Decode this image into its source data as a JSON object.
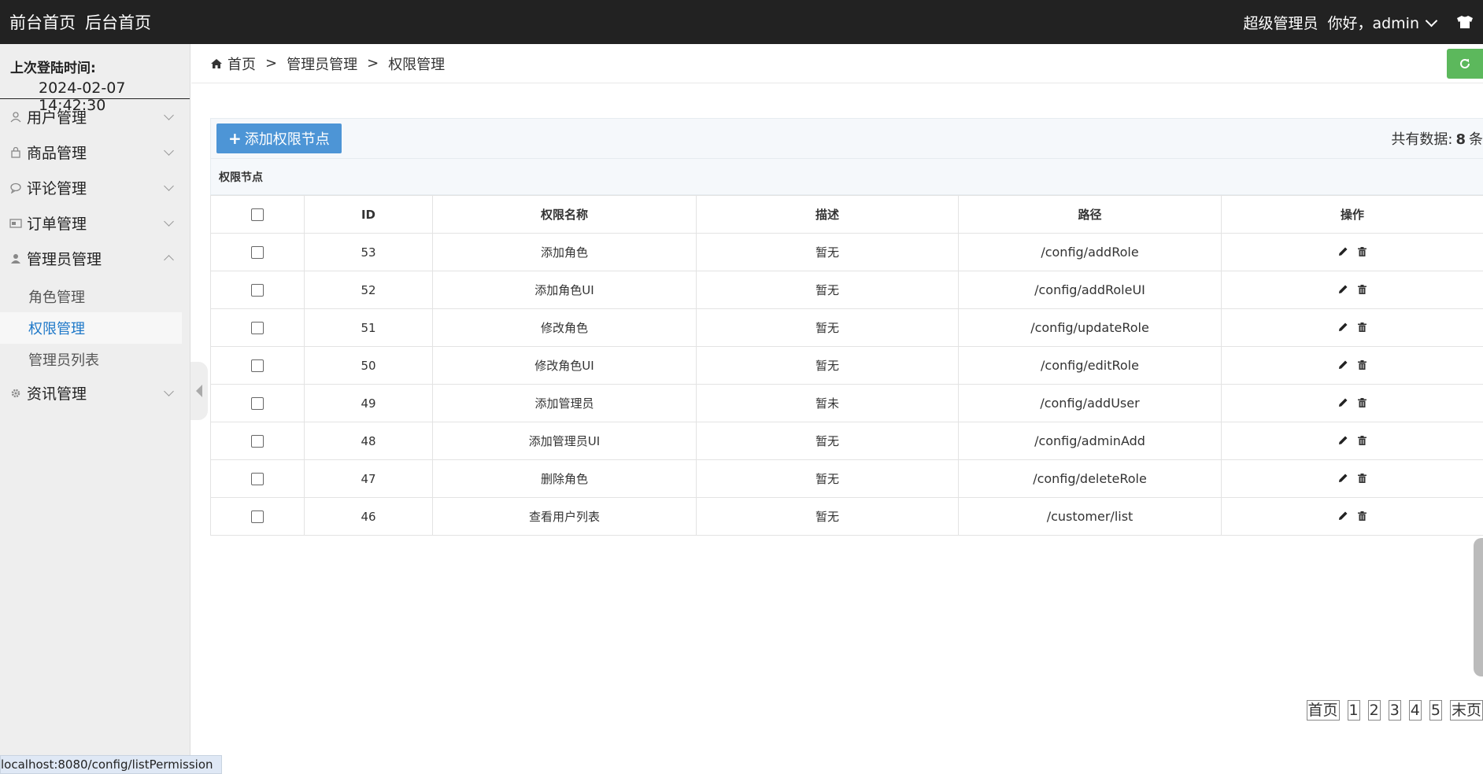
{
  "topbar": {
    "front_home": "前台首页",
    "back_home": "后台首页",
    "role": "超级管理员",
    "greeting": "你好，admin"
  },
  "sidebar": {
    "last_login_label": "上次登陆时间:",
    "last_login_value": "2024-02-07 14:42:30",
    "menus": [
      "用户管理",
      "商品管理",
      "评论管理",
      "订单管理",
      "管理员管理",
      "资讯管理"
    ],
    "admin_sub": [
      "角色管理",
      "权限管理",
      "管理员列表"
    ]
  },
  "breadcrumb": [
    "首页",
    "管理员管理",
    "权限管理"
  ],
  "toolbar": {
    "add_label": "添加权限节点",
    "total_prefix": "共有数据:",
    "total_count": "8",
    "total_suffix": "条"
  },
  "table": {
    "title": "权限节点",
    "headers": [
      "ID",
      "权限名称",
      "描述",
      "路径",
      "操作"
    ],
    "rows": [
      {
        "id": "53",
        "name": "添加角色",
        "desc": "暂无",
        "path": "/config/addRole"
      },
      {
        "id": "52",
        "name": "添加角色UI",
        "desc": "暂无",
        "path": "/config/addRoleUI"
      },
      {
        "id": "51",
        "name": "修改角色",
        "desc": "暂无",
        "path": "/config/updateRole"
      },
      {
        "id": "50",
        "name": "修改角色UI",
        "desc": "暂无",
        "path": "/config/editRole"
      },
      {
        "id": "49",
        "name": "添加管理员",
        "desc": "暂未",
        "path": "/config/addUser"
      },
      {
        "id": "48",
        "name": "添加管理员UI",
        "desc": "暂无",
        "path": "/config/adminAdd"
      },
      {
        "id": "47",
        "name": "删除角色",
        "desc": "暂无",
        "path": "/config/deleteRole"
      },
      {
        "id": "46",
        "name": "查看用户列表",
        "desc": "暂无",
        "path": "/customer/list"
      }
    ]
  },
  "pagination": [
    "首页",
    "1",
    "2",
    "3",
    "4",
    "5",
    "末页"
  ],
  "status_url": "localhost:8080/config/listPermission",
  "colors": {
    "topbar": "#222222",
    "accent": "#4d95d6",
    "active_link": "#1e78c8",
    "refresh": "#5cb85c"
  }
}
